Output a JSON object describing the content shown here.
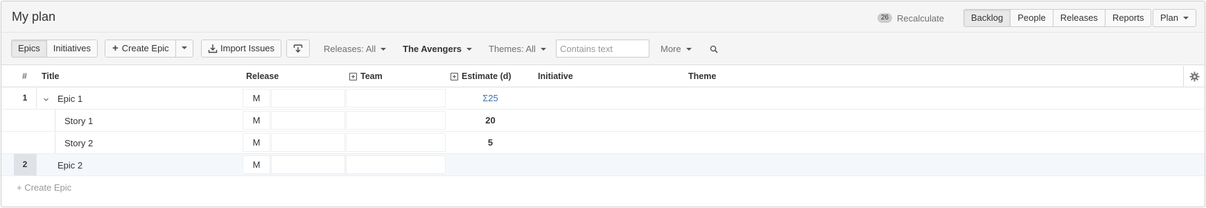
{
  "header": {
    "title": "My plan",
    "recalc_count": "26",
    "recalc_label": "Recalculate",
    "views": [
      "Backlog",
      "People",
      "Releases",
      "Reports"
    ],
    "active_view": "Backlog",
    "plan_label": "Plan"
  },
  "toolbar": {
    "epics_label": "Epics",
    "initiatives_label": "Initiatives",
    "create_epic_label": "Create Epic",
    "import_label": "Import Issues",
    "releases_filter": "Releases: All",
    "team_filter": "The Avengers",
    "themes_filter": "Themes: All",
    "search_placeholder": "Contains text",
    "more_label": "More"
  },
  "columns": {
    "rank": "#",
    "title": "Title",
    "release": "Release",
    "team": "Team",
    "estimate": "Estimate (d)",
    "initiative": "Initiative",
    "theme": "Theme"
  },
  "rows": [
    {
      "rank": "1",
      "title": "Epic 1",
      "release": "M",
      "estimate": "Σ25",
      "kind": "epic"
    },
    {
      "rank": "",
      "title": "Story 1",
      "release": "M",
      "estimate": "20",
      "kind": "story"
    },
    {
      "rank": "",
      "title": "Story 2",
      "release": "M",
      "estimate": "5",
      "kind": "story"
    },
    {
      "rank": "2",
      "title": "Epic 2",
      "release": "M",
      "estimate": "",
      "kind": "epic"
    }
  ],
  "footer": {
    "create_epic_link": "+ Create Epic"
  },
  "colors": {
    "accent_link": "#3b73af",
    "selected_row": "#f4f8fc",
    "toolbar_bg": "#f5f5f5"
  },
  "icons": [
    "chevron-down-icon",
    "plus-icon",
    "import-icon",
    "export-icon",
    "search-icon",
    "gear-icon",
    "expand-icon"
  ]
}
